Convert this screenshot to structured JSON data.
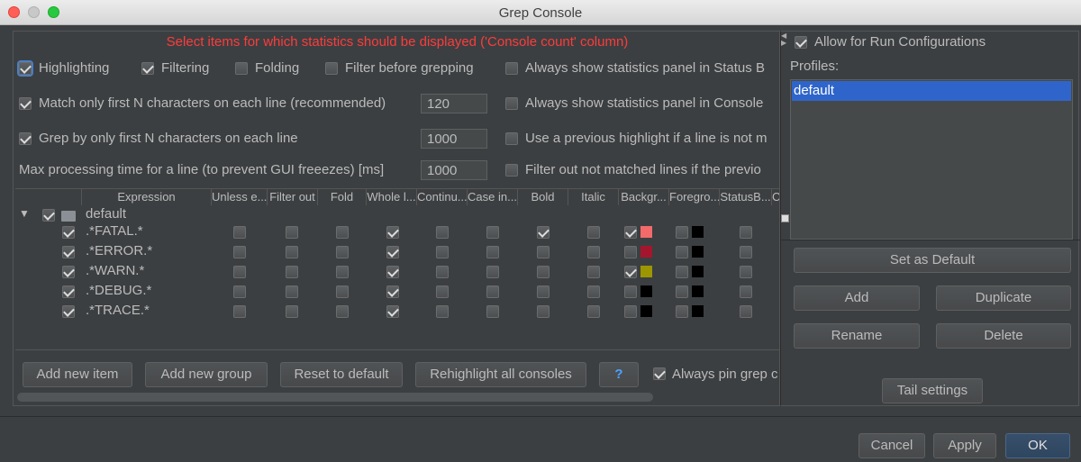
{
  "window": {
    "title": "Grep Console"
  },
  "notice": "Select items for which statistics should be displayed ('Console count' column)",
  "options": {
    "highlighting": "Highlighting",
    "filtering": "Filtering",
    "folding": "Folding",
    "filter_before": "Filter before grepping",
    "always_status": "Always show statistics panel in Status B",
    "match_first_n": "Match only first N characters on each line (recommended)",
    "match_first_n_value": "120",
    "always_console": "Always show statistics panel in Console",
    "grep_first_n": "Grep by only first N characters on each line",
    "grep_first_n_value": "1000",
    "prev_highlight": "Use a previous highlight if a line is not m",
    "max_time": "Max processing time for a line (to prevent GUI freeezes) [ms]",
    "max_time_value": "1000",
    "filter_out": "Filter out not matched lines if the previo"
  },
  "table": {
    "columns": [
      "Expression",
      "Unless e...",
      "Filter out",
      "Fold",
      "Whole l...",
      "Continu...",
      "Case in...",
      "Bold",
      "Italic",
      "Backgr...",
      "Foregro...",
      "StatusB...",
      "C"
    ],
    "group": "default",
    "rows": [
      {
        "expr": ".*FATAL.*",
        "whole": true,
        "bold": true,
        "bg_checked": true,
        "bg": "#f36a6a",
        "fg": "#000000"
      },
      {
        "expr": ".*ERROR.*",
        "whole": true,
        "bold": false,
        "bg_checked": false,
        "bg": "#a4162d",
        "fg": "#000000"
      },
      {
        "expr": ".*WARN.*",
        "whole": true,
        "bold": false,
        "bg_checked": true,
        "bg": "#9c9600",
        "fg": "#000000"
      },
      {
        "expr": ".*DEBUG.*",
        "whole": true,
        "bold": false,
        "bg_checked": false,
        "bg": "#000000",
        "fg": "#000000"
      },
      {
        "expr": ".*TRACE.*",
        "whole": true,
        "bold": false,
        "bg_checked": false,
        "bg": "#000000",
        "fg": "#000000"
      }
    ]
  },
  "buttons": {
    "add_item": "Add new item",
    "add_group": "Add new group",
    "reset": "Reset to default",
    "rehighlight": "Rehighlight all consoles",
    "help": "?",
    "always_pin": "Always pin grep c"
  },
  "right": {
    "allow_run": "Allow for Run Configurations",
    "profiles_label": "Profiles:",
    "profiles": [
      "default"
    ],
    "set_default": "Set as Default",
    "add": "Add",
    "duplicate": "Duplicate",
    "rename": "Rename",
    "delete": "Delete",
    "tail": "Tail settings"
  },
  "footer": {
    "cancel": "Cancel",
    "apply": "Apply",
    "ok": "OK"
  },
  "colors": {
    "accent": "#2f65ca",
    "notice": "#ff3b3b",
    "background": "#3c3f41"
  }
}
